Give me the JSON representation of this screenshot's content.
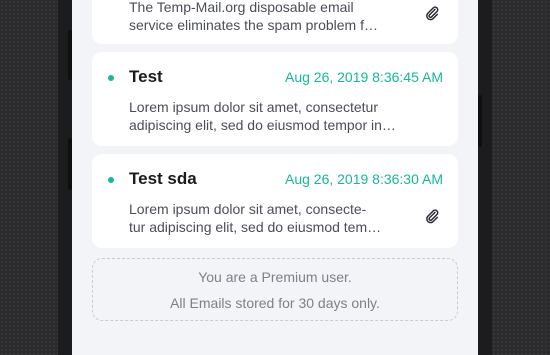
{
  "emails": [
    {
      "subject": "",
      "date": "",
      "preview_lines": [
        "The Temp-Mail.org disposable email",
        "service eliminates the spam problem f…"
      ],
      "has_attachment": true,
      "unread": false
    },
    {
      "subject": "Test",
      "date": "Aug 26, 2019 8:36:45 AM",
      "preview_lines": [
        "Lorem ipsum dolor sit amet, consectetur",
        "adipiscing elit, sed do eiusmod tempor in…"
      ],
      "has_attachment": false,
      "unread": true
    },
    {
      "subject": "Test sda",
      "date": "Aug 26, 2019 8:36:30 AM",
      "preview_lines": [
        "Lorem ipsum dolor sit amet, consecte-",
        "tur adipiscing elit, sed do eiusmod tem…"
      ],
      "has_attachment": true,
      "unread": true
    }
  ],
  "premium_notice": {
    "title": "You are a Premium user.",
    "subtitle": "All Emails stored for 30 days only."
  },
  "icons": {
    "attachment": "paperclip-icon",
    "unread": "unread-dot"
  },
  "colors": {
    "accent": "#17b79a",
    "screen_background": "#f3f4f8",
    "card_background": "#ffffff",
    "text_primary": "#1b1b1f",
    "text_secondary": "#4b4e57",
    "notice_text": "#7d808a"
  }
}
